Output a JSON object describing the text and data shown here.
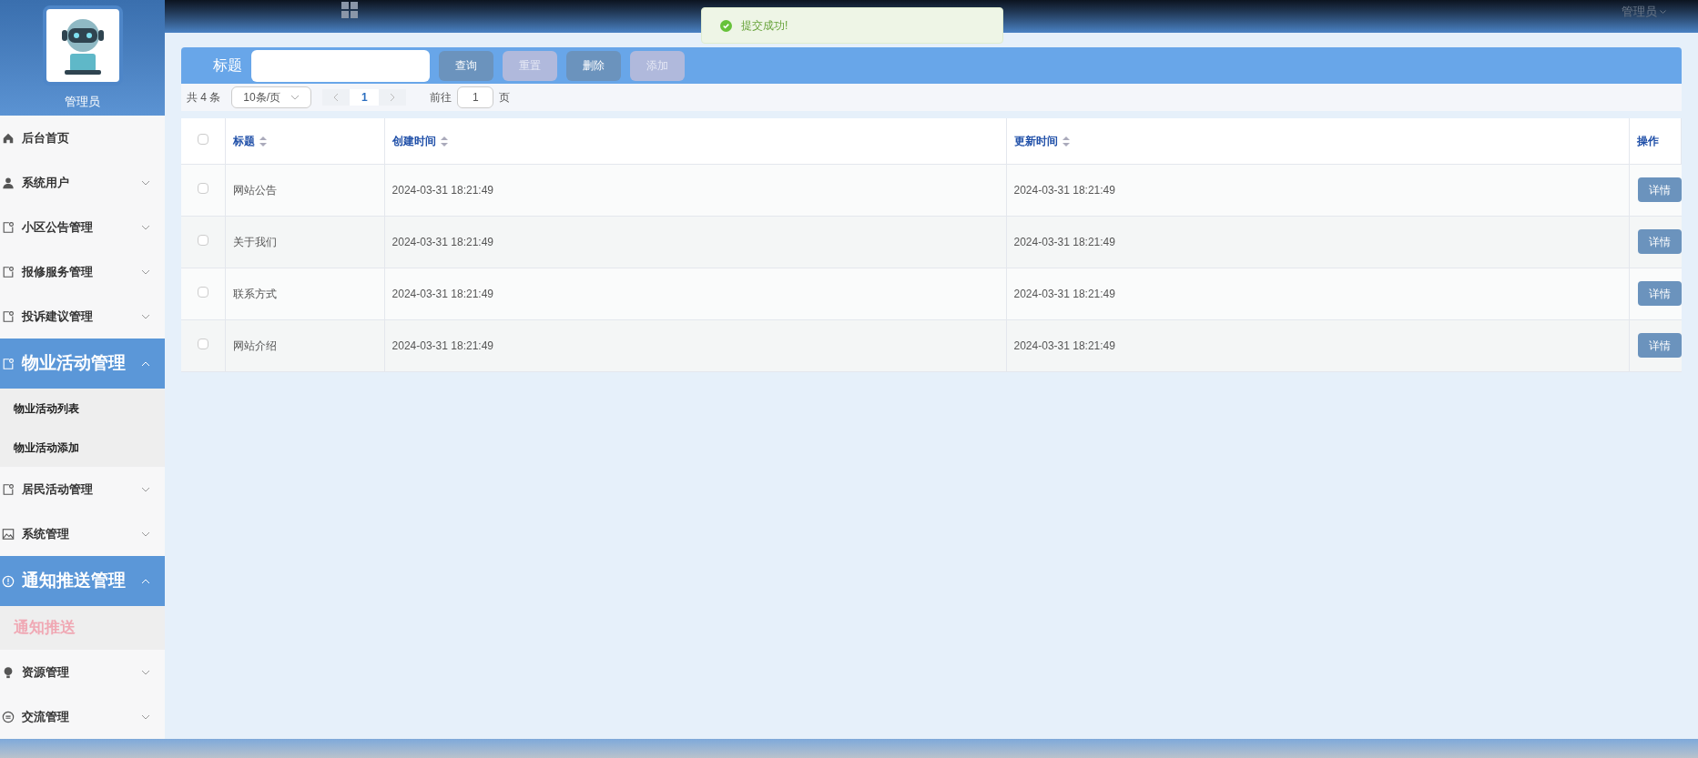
{
  "header": {
    "user_menu": "管理员"
  },
  "sidebar": {
    "profile_name": "管理员",
    "items": [
      {
        "label": "后台首页",
        "kind": "home",
        "expanded": false
      },
      {
        "label": "系统用户",
        "kind": "user",
        "expanded": false
      },
      {
        "label": "小区公告管理",
        "kind": "doc",
        "expanded": false
      },
      {
        "label": "报修服务管理",
        "kind": "doc",
        "expanded": false
      },
      {
        "label": "投诉建议管理",
        "kind": "doc",
        "expanded": false
      },
      {
        "label": "物业活动管理",
        "kind": "doc",
        "expanded": true,
        "children": [
          {
            "label": "物业活动列表",
            "selected": false
          },
          {
            "label": "物业活动添加",
            "selected": false
          }
        ]
      },
      {
        "label": "居民活动管理",
        "kind": "doc",
        "expanded": false
      },
      {
        "label": "系统管理",
        "kind": "image",
        "expanded": false
      },
      {
        "label": "通知推送管理",
        "kind": "alert",
        "expanded": true,
        "children": [
          {
            "label": "通知推送",
            "selected": true
          }
        ]
      },
      {
        "label": "资源管理",
        "kind": "bulb",
        "expanded": false
      },
      {
        "label": "交流管理",
        "kind": "chat",
        "expanded": false
      }
    ]
  },
  "toast": {
    "message": "提交成功!"
  },
  "search": {
    "label": "标题",
    "buttons": [
      {
        "label": "查询",
        "disabled": false
      },
      {
        "label": "重置",
        "disabled": true
      },
      {
        "label": "删除",
        "disabled": false
      },
      {
        "label": "添加",
        "disabled": true
      }
    ]
  },
  "pagination": {
    "total": "共 4 条",
    "page_size": "10条/页",
    "current_page": "1",
    "goto_label": "前往",
    "goto_value": "1",
    "goto_suffix": "页"
  },
  "table": {
    "select_all_checked": false,
    "columns": [
      "标题",
      "创建时间",
      "更新时间",
      "操作"
    ],
    "rows": [
      {
        "checked": false,
        "title": "网站公告",
        "created": "2024-03-31 18:21:49",
        "updated": "2024-03-31 18:21:49",
        "action": "详情"
      },
      {
        "checked": false,
        "title": "关于我们",
        "created": "2024-03-31 18:21:49",
        "updated": "2024-03-31 18:21:49",
        "action": "详情"
      },
      {
        "checked": false,
        "title": "联系方式",
        "created": "2024-03-31 18:21:49",
        "updated": "2024-03-31 18:21:49",
        "action": "详情"
      },
      {
        "checked": false,
        "title": "网站介绍",
        "created": "2024-03-31 18:21:49",
        "updated": "2024-03-31 18:21:49",
        "action": "详情"
      }
    ]
  }
}
